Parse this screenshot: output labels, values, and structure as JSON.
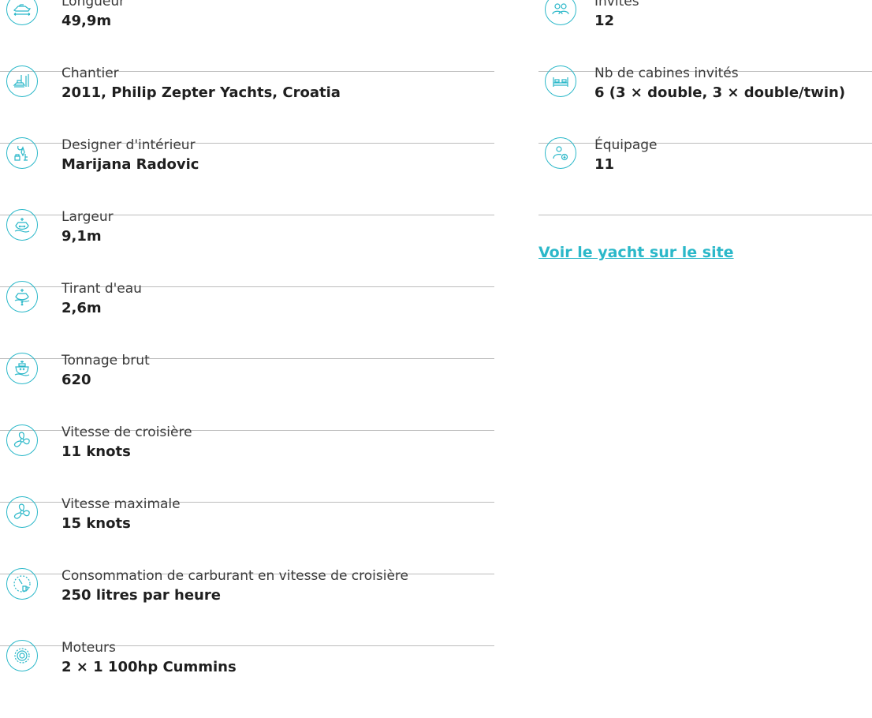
{
  "accent_color": "#2bb8c9",
  "specs_left": [
    {
      "icon": "yacht-length-icon",
      "label": "Longueur",
      "value": "49,9m"
    },
    {
      "icon": "shipyard-icon",
      "label": "Chantier",
      "value": "2011, Philip Zepter Yachts, Croatia"
    },
    {
      "icon": "interior-designer-icon",
      "label": "Designer d'intérieur",
      "value": "Marijana Radovic"
    },
    {
      "icon": "beam-icon",
      "label": "Largeur",
      "value": "9,1m"
    },
    {
      "icon": "draft-icon",
      "label": "Tirant d'eau",
      "value": "2,6m"
    },
    {
      "icon": "gross-tonnage-icon",
      "label": "Tonnage brut",
      "value": "620"
    },
    {
      "icon": "propeller-icon",
      "label": "Vitesse de croisière",
      "value": "11 knots"
    },
    {
      "icon": "propeller-icon",
      "label": "Vitesse maximale",
      "value": "15 knots"
    },
    {
      "icon": "fuel-gauge-icon",
      "label": "Consommation de carburant en vitesse de croisière",
      "value": "250 litres par heure"
    },
    {
      "icon": "engine-gear-icon",
      "label": "Moteurs",
      "value": "2 × 1 100hp Cummins"
    }
  ],
  "specs_right": [
    {
      "icon": "guests-icon",
      "label": "Invités",
      "value": "12"
    },
    {
      "icon": "bed-icon",
      "label": "Nb de cabines invités",
      "value": "6 (3 × double, 3 × double/twin)"
    },
    {
      "icon": "crew-icon",
      "label": "Équipage",
      "value": "11"
    }
  ],
  "site_link": "Voir le yacht sur le site"
}
